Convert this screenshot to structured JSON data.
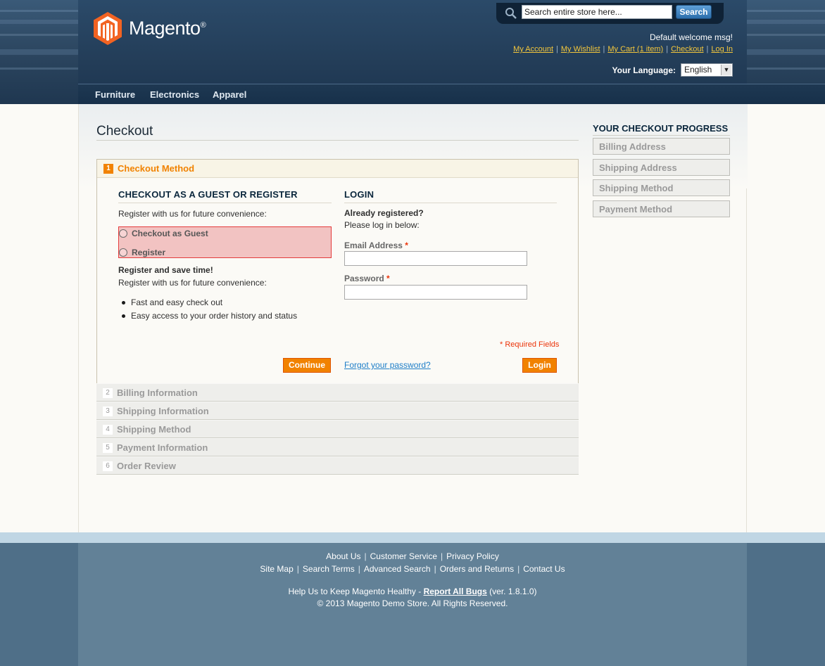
{
  "header": {
    "logo_text": "Magento",
    "logo_reg": "®",
    "search": {
      "placeholder": "Search entire store here...",
      "value": "Search entire store here...",
      "button": "Search"
    },
    "welcome": "Default welcome msg!",
    "links": [
      "My Account",
      "My Wishlist",
      "My Cart (1 item)",
      "Checkout",
      "Log In"
    ],
    "language": {
      "label": "Your Language:",
      "selected": "English"
    },
    "nav": [
      "Furniture",
      "Electronics",
      "Apparel"
    ]
  },
  "page": {
    "title": "Checkout",
    "step1": {
      "number": "1",
      "title": "Checkout Method",
      "guest_col": {
        "heading": "CHECKOUT AS A GUEST OR REGISTER",
        "intro": "Register with us for future convenience:",
        "options": [
          "Checkout as Guest",
          "Register"
        ],
        "save_title": "Register and save time!",
        "save_text": "Register with us for future convenience:",
        "benefits": [
          "Fast and easy check out",
          "Easy access to your order history and status"
        ],
        "continue": "Continue"
      },
      "login_col": {
        "heading": "LOGIN",
        "already": "Already registered?",
        "please": "Please log in below:",
        "email_label": "Email Address",
        "password_label": "Password",
        "required_mark": "*",
        "required_note": "* Required Fields",
        "forgot": "Forgot your password?",
        "login": "Login"
      }
    },
    "steps": [
      {
        "number": "2",
        "title": "Billing Information"
      },
      {
        "number": "3",
        "title": "Shipping Information"
      },
      {
        "number": "4",
        "title": "Shipping Method"
      },
      {
        "number": "5",
        "title": "Payment Information"
      },
      {
        "number": "6",
        "title": "Order Review"
      }
    ]
  },
  "sidebar": {
    "title": "YOUR CHECKOUT PROGRESS",
    "items": [
      "Billing Address",
      "Shipping Address",
      "Shipping Method",
      "Payment Method"
    ]
  },
  "footer": {
    "row1": [
      "About Us",
      "Customer Service",
      "Privacy Policy"
    ],
    "row2": [
      "Site Map",
      "Search Terms",
      "Advanced Search",
      "Orders and Returns",
      "Contact Us"
    ],
    "help_prefix": "Help Us to Keep Magento Healthy - ",
    "help_link": "Report All Bugs",
    "version": " (ver. 1.8.1.0)",
    "copyright": "© 2013 Magento Demo Store. All Rights Reserved."
  },
  "colors": {
    "accent": "#f18200",
    "link": "#1e7ec8",
    "header": "#233d58",
    "highlight": "#f2c3c2"
  }
}
